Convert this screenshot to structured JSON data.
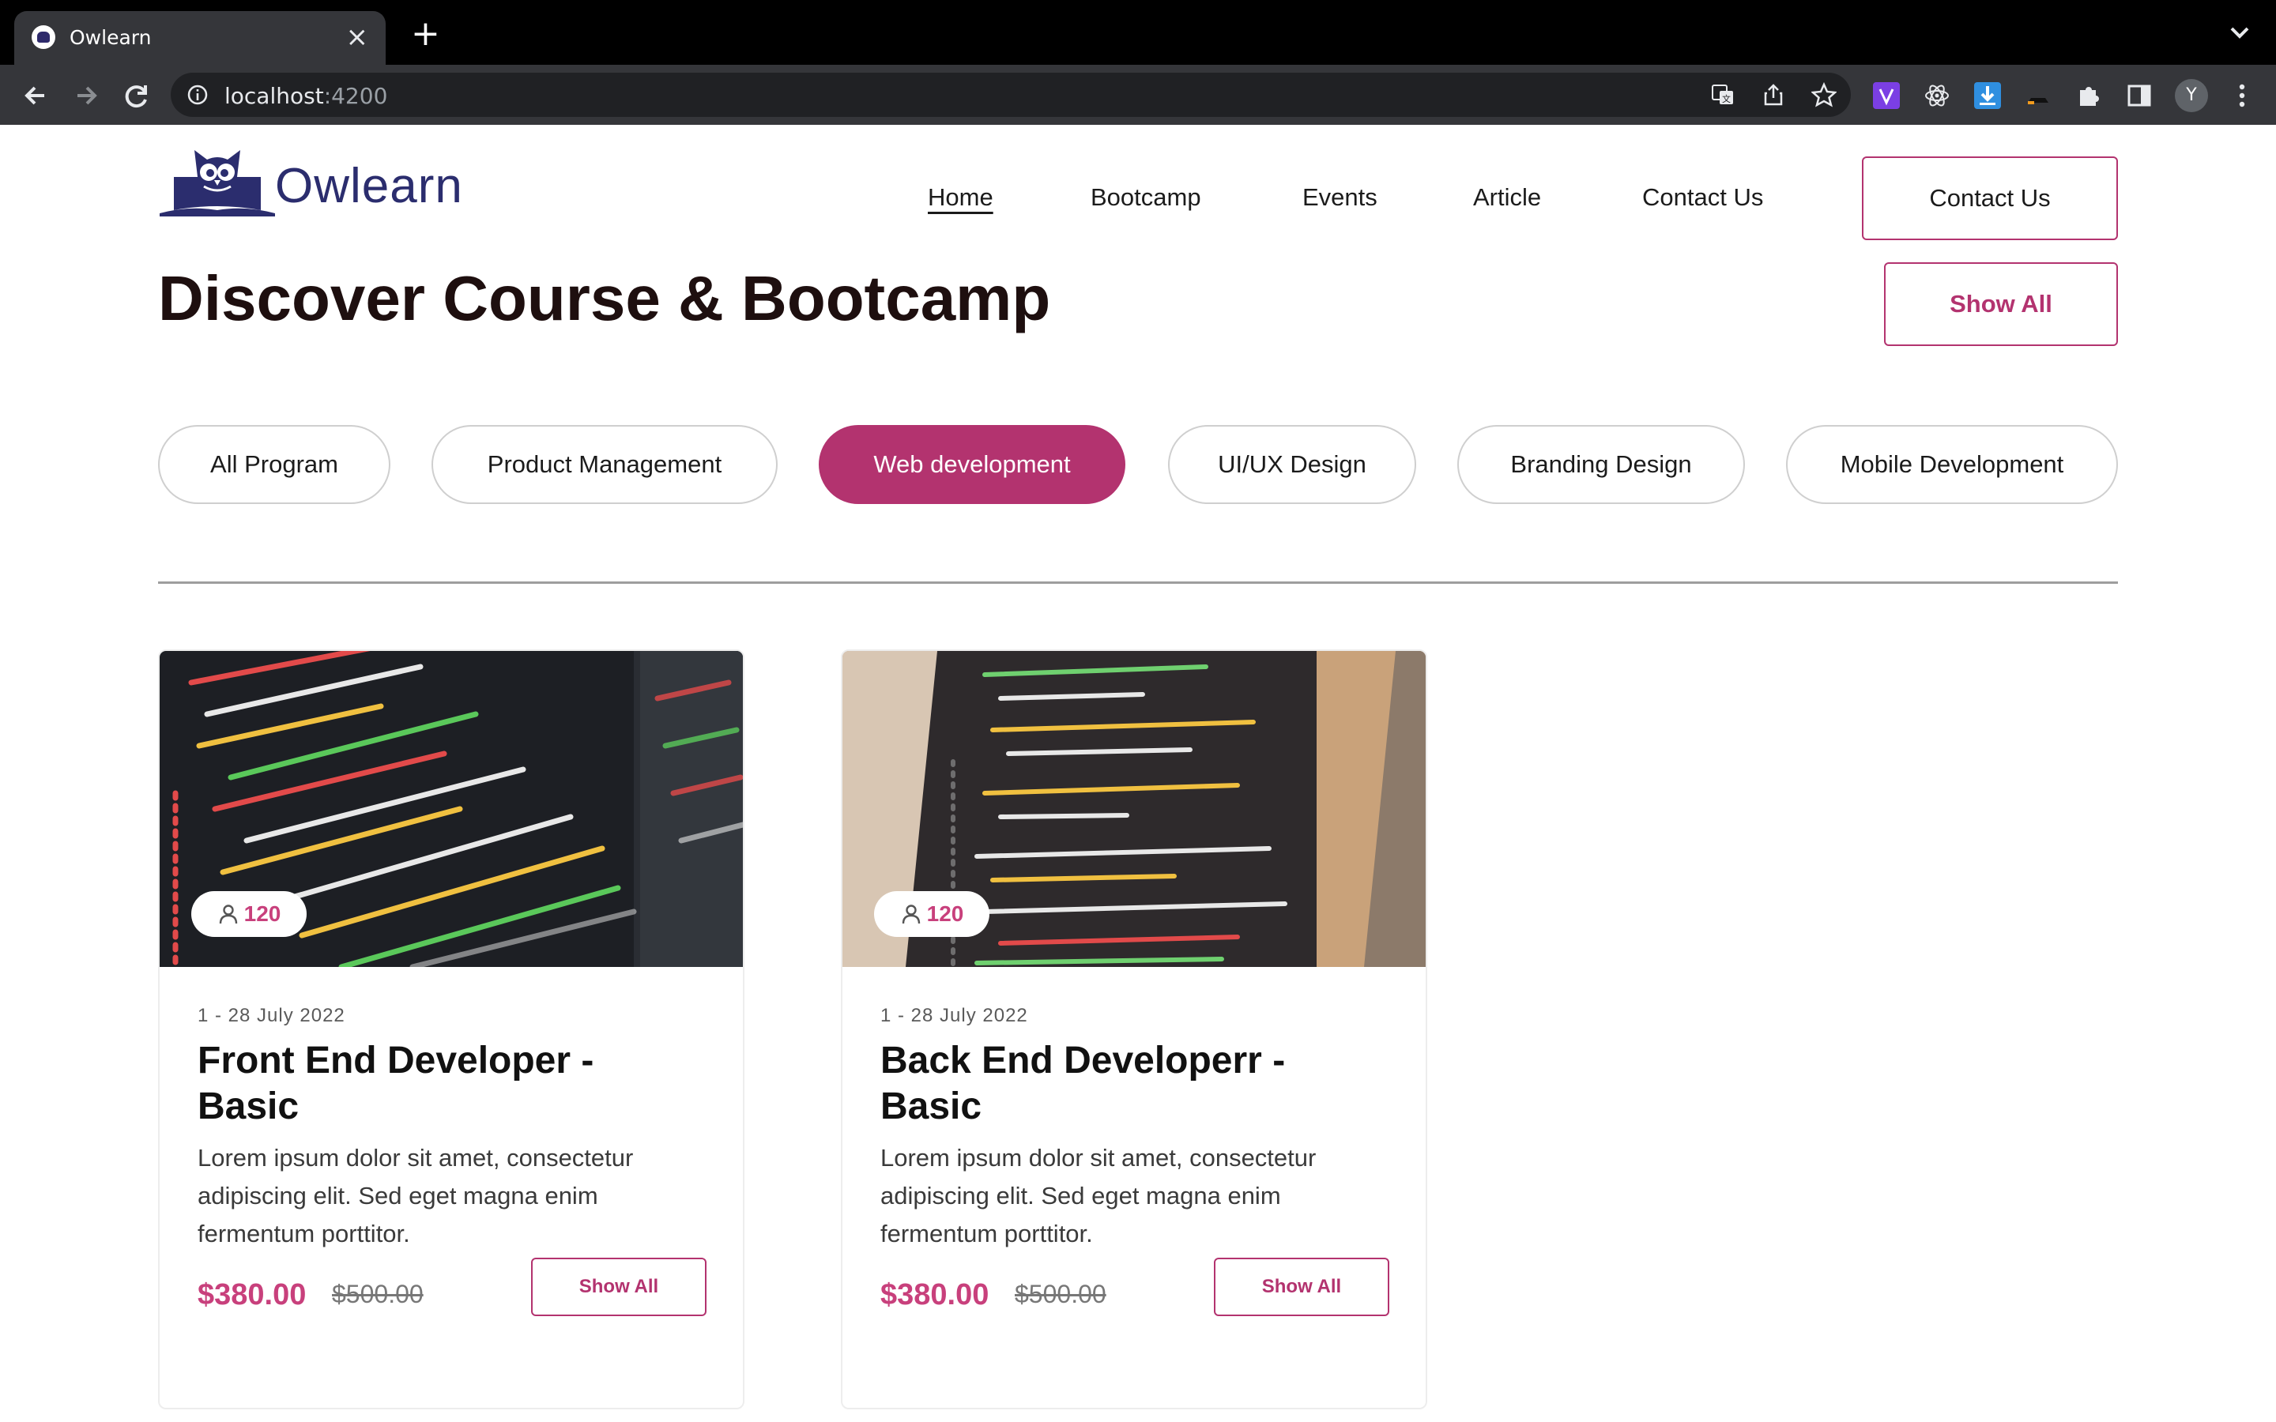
{
  "browser": {
    "tab_title": "Owlearn",
    "url_host": "localhost",
    "url_port": ":4200",
    "profile_initial": "Y"
  },
  "header": {
    "logo_text": "Owlearn",
    "nav": [
      "Home",
      "Bootcamp",
      "Events",
      "Article",
      "Contact Us"
    ],
    "contact_button": "Contact Us"
  },
  "main": {
    "headline": "Discover Course & Bootcamp",
    "show_all": "Show All",
    "categories": [
      "All Program",
      "Product Management",
      "Web development",
      "UI/UX Design",
      "Branding Design",
      "Mobile Development"
    ],
    "active_category": "Web development"
  },
  "courses": [
    {
      "participants": "120",
      "date": "1 - 28 July 2022",
      "title": "Front End Developer - Basic",
      "description": "Lorem ipsum dolor sit amet, consectetur adipiscing elit. Sed eget magna enim fermentum porttitor.",
      "price": "$380.00",
      "old_price": "$500.00",
      "button": "Show All"
    },
    {
      "participants": "120",
      "date": "1 - 28 July 2022",
      "title": "Back End Developerr - Basic",
      "description": "Lorem ipsum dolor sit amet, consectetur adipiscing elit. Sed eget magna enim fermentum porttitor.",
      "price": "$380.00",
      "old_price": "$500.00",
      "button": "Show All"
    }
  ],
  "colors": {
    "accent": "#b3336f",
    "price": "#c8407c",
    "logo": "#2b2d6e"
  }
}
